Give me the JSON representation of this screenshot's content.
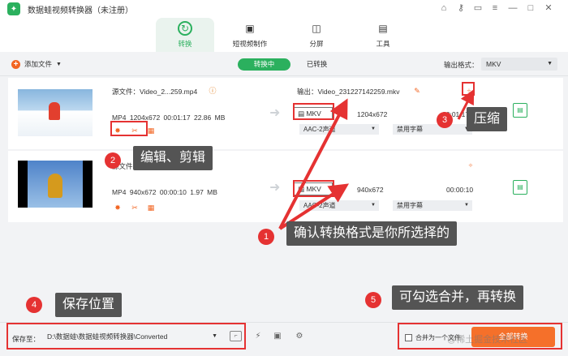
{
  "app": {
    "title": "数据蛙视频转换器（未注册）",
    "logo": "frog-logo"
  },
  "nav": [
    {
      "label": "转换",
      "icon": "convert-icon"
    },
    {
      "label": "短视频制作",
      "icon": "short-video-icon"
    },
    {
      "label": "分屏",
      "icon": "split-screen-icon"
    },
    {
      "label": "工具",
      "icon": "toolbox-icon"
    }
  ],
  "toolbar": {
    "add_label": "添加文件",
    "converting_tab": "转换中",
    "converted_tab": "已转换",
    "output_format_label": "输出格式：",
    "output_format_value": "MKV"
  },
  "files": [
    {
      "source_label": "源文件：Video_2...259.mp4",
      "source_info": "MP4  1204x672  00:01:17  22.86 MB",
      "output_label": "输出：Video_231227142259.mkv",
      "format": "MKV",
      "resolution": "1204x672",
      "duration": "00:01:17",
      "audio": "AAC-2声道",
      "subtitle": "禁用字幕"
    },
    {
      "source_label": "源文件：Video_2...229.mp4",
      "source_info": "MP4  940x672  00:00:10  1.97 MB",
      "output_label": "输出：Video_231227142229.mkv",
      "format": "MKV",
      "resolution": "940x672",
      "duration": "00:00:10",
      "audio": "AAC-2声道",
      "subtitle": "禁用字幕"
    }
  ],
  "bottom": {
    "save_label": "保存至：",
    "save_path": "D:\\数据蛙\\数据蛙视频转换器\\Converted",
    "merge_label": "合并为一个文件",
    "convert_all": "全部转换"
  },
  "annotations": [
    {
      "num": "1",
      "text": "确认转换格式是你所选择的"
    },
    {
      "num": "2",
      "text": "编辑、剪辑"
    },
    {
      "num": "3",
      "text": "压缩"
    },
    {
      "num": "4",
      "text": "保存位置"
    },
    {
      "num": "5",
      "text": "可勾选合并，再转换"
    }
  ],
  "watermark": "@稀土掘金技术社区",
  "colors": {
    "brand_green": "#2bb05e",
    "accent_orange": "#f5702a",
    "annotation_red": "#e53232"
  }
}
